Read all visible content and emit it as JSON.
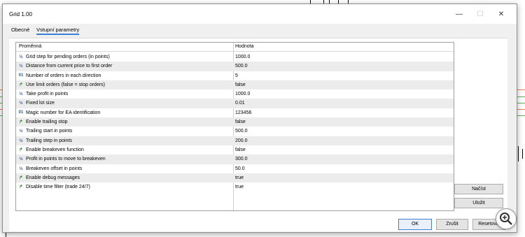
{
  "window": {
    "title": "Grid 1.00",
    "minimize_glyph": "—",
    "maximize_glyph": "☐",
    "close_glyph": "✕"
  },
  "tabs": [
    {
      "label": "Obecné",
      "active": false
    },
    {
      "label": "Vstupní parametry",
      "active": true
    }
  ],
  "table": {
    "headers": {
      "name": "Proměnná",
      "value": "Hodnota"
    },
    "rows": [
      {
        "type": "double",
        "name": "Grid step for pending orders (in points)",
        "value": "1000.0"
      },
      {
        "type": "double",
        "name": "Distance from current price to first order",
        "value": "500.0"
      },
      {
        "type": "int",
        "name": "Number of orders in each direction",
        "value": "5"
      },
      {
        "type": "bool",
        "name": "Use limit orders (false = stop orders)",
        "value": "false"
      },
      {
        "type": "double",
        "name": "Take profit in points",
        "value": "1000.0"
      },
      {
        "type": "double",
        "name": "Fixed lot size",
        "value": "0.01"
      },
      {
        "type": "int",
        "name": "Magic number for EA identification",
        "value": "123456"
      },
      {
        "type": "bool",
        "name": "Enable trailing stop",
        "value": "false"
      },
      {
        "type": "double",
        "name": "Trailing start in points",
        "value": "500.0"
      },
      {
        "type": "double",
        "name": "Trailing step in points",
        "value": "200.0"
      },
      {
        "type": "bool",
        "name": "Enable breakeven function",
        "value": "false"
      },
      {
        "type": "double",
        "name": "Profit in points to move to breakeven",
        "value": "300.0"
      },
      {
        "type": "double",
        "name": "Breakeven offset in points",
        "value": "50.0"
      },
      {
        "type": "bool",
        "name": "Enable debug messages",
        "value": "true"
      },
      {
        "type": "bool",
        "name": "Disable time filter (trade 24/7)",
        "value": "true"
      }
    ]
  },
  "icons": {
    "double": "½",
    "int": "01",
    "bool": "↱"
  },
  "side_buttons": {
    "load": "Načíst",
    "save": "Uložit"
  },
  "bottom_buttons": {
    "ok": "OK",
    "cancel": "Zrušit",
    "reset": "Resetovat"
  },
  "colors": {
    "accent": "#3c7fd8",
    "row_alt": "#ececec",
    "bool_icon": "#2b8a2b",
    "num_icon": "#2a5aa8"
  }
}
